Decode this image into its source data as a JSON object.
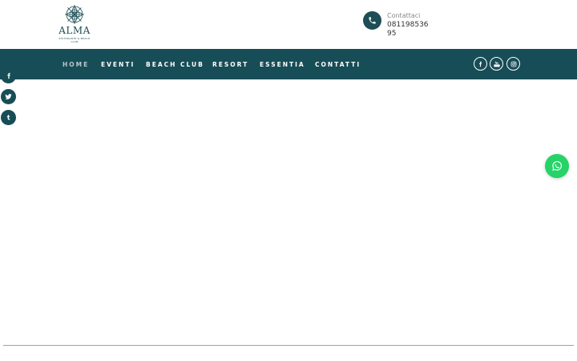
{
  "brand": {
    "name": "ALMA",
    "tagline": "RISTORANTE & BEACH CLUB"
  },
  "contact": {
    "label": "Contattaci",
    "phone": "08119853695",
    "icon": "phone-icon"
  },
  "nav": {
    "items": [
      {
        "label": "HOME",
        "active": true
      },
      {
        "label": "EVENTI",
        "active": false
      },
      {
        "label": "BEACH CLUB",
        "active": false
      },
      {
        "label": "RESORT",
        "active": false
      },
      {
        "label": "ESSENTIA",
        "active": false
      },
      {
        "label": "CONTATTI",
        "active": false
      }
    ],
    "social": [
      "facebook-icon",
      "youtube-icon",
      "instagram-icon"
    ]
  },
  "side_social": [
    "facebook-icon",
    "twitter-icon",
    "tumblr-icon"
  ],
  "floating": {
    "icon": "whatsapp-icon"
  },
  "colors": {
    "brand": "#174d57",
    "nav_active": "#b7c9cc",
    "whatsapp": "#25d366",
    "rule": "#8aa7b8"
  }
}
